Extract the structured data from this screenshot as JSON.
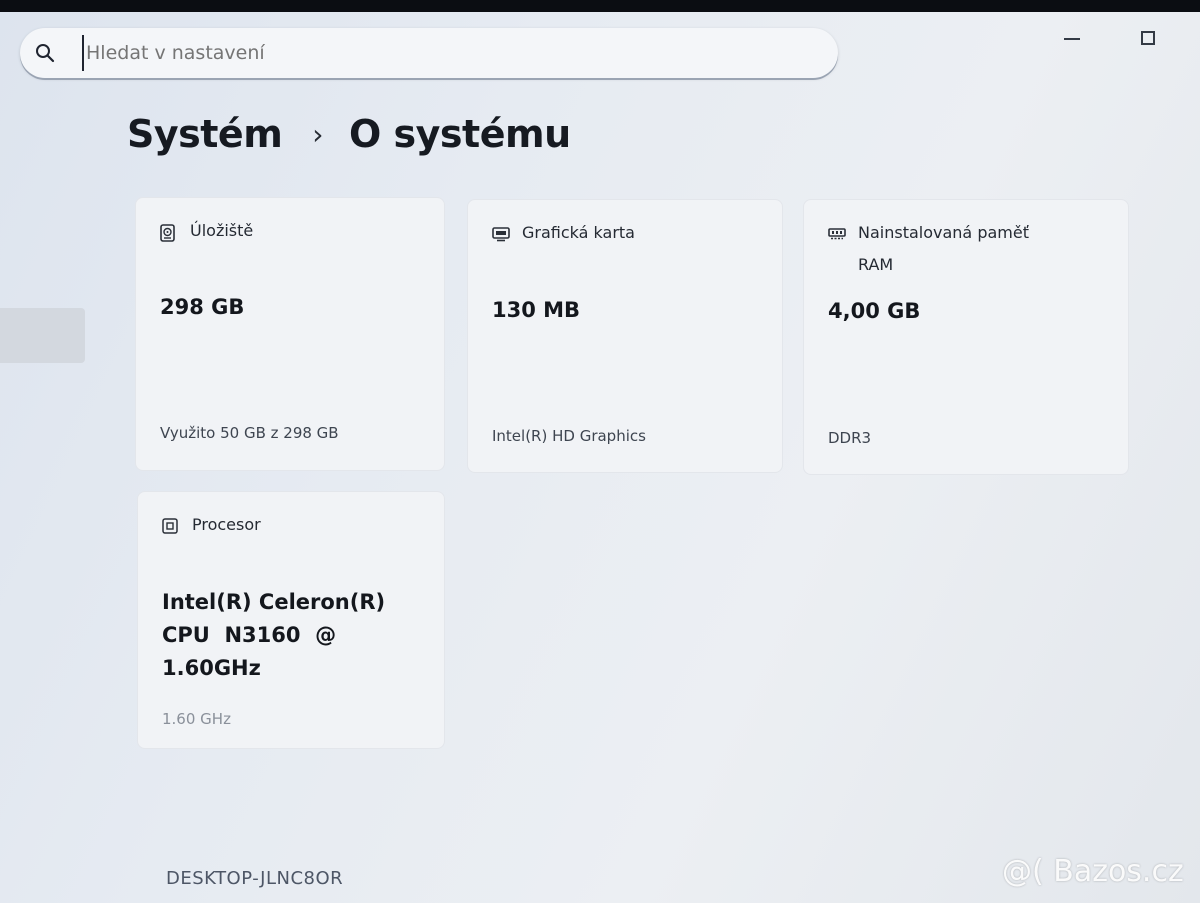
{
  "search": {
    "placeholder": "Hledat v nastavení"
  },
  "breadcrumb": {
    "parent": "Systém",
    "separator": "›",
    "current": "O systému"
  },
  "cards": {
    "storage": {
      "label": "Úložiště",
      "value": "298 GB",
      "detail": "Využito 50 GB z 298 GB",
      "icon": "storage-icon"
    },
    "graphics": {
      "label": "Grafická karta",
      "value": "130 MB",
      "detail": "Intel(R) HD Graphics",
      "icon": "display-icon"
    },
    "ram": {
      "label": "Nainstalovaná paměť RAM",
      "value": "4,00 GB",
      "detail": "DDR3",
      "icon": "memory-icon"
    },
    "cpu": {
      "label": "Procesor",
      "value": "Intel(R) Celeron(R) CPU  N3160  @ 1.60GHz",
      "detail": "1.60 GHz",
      "icon": "cpu-icon"
    }
  },
  "footer": {
    "device_name": "DESKTOP-JLNC8OR"
  },
  "watermark": {
    "text": "@( Bazos.cz"
  },
  "colors": {
    "background": "#e6ebf2",
    "card": "#f1f3f6",
    "text": "#14171d"
  }
}
